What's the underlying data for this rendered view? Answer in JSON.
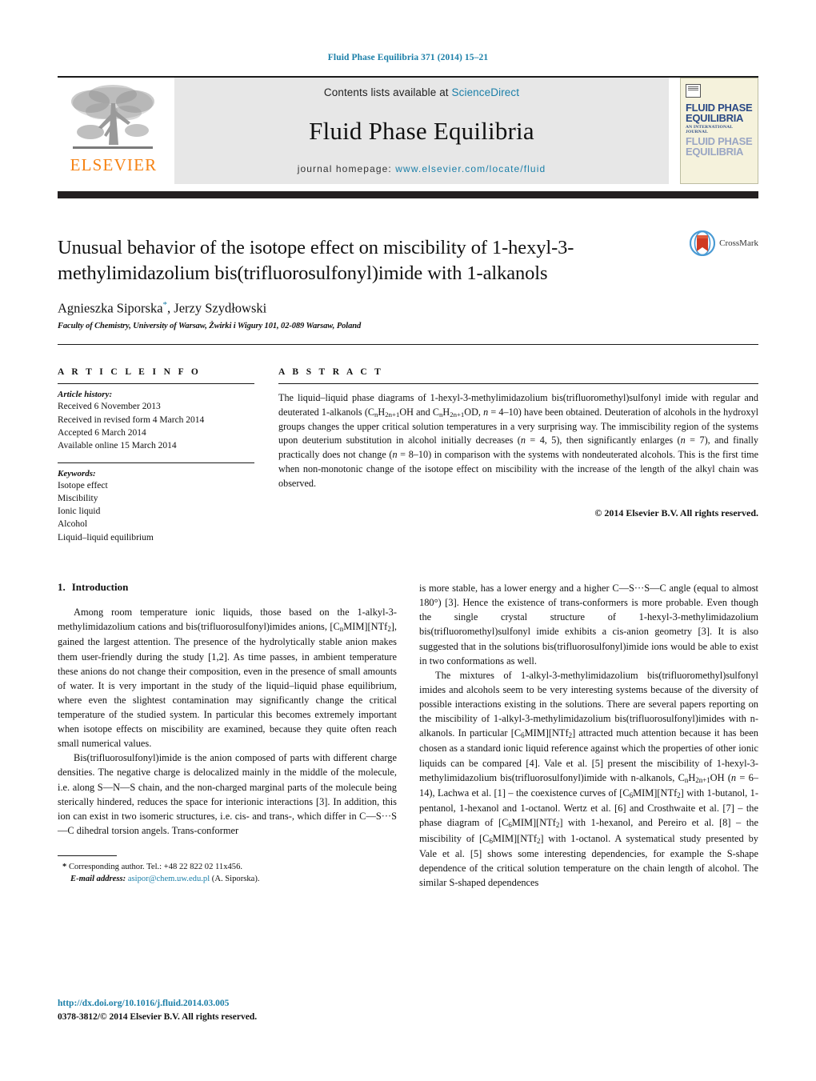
{
  "running_head": "Fluid Phase Equilibria 371 (2014) 15–21",
  "masthead": {
    "publisher_name": "ELSEVIER",
    "contents_prefix": "Contents lists available at",
    "contents_link": "ScienceDirect",
    "journal_title": "Fluid Phase Equilibria",
    "homepage_prefix": "journal homepage:",
    "homepage_url": "www.elsevier.com/locate/fluid",
    "cover": {
      "line1": "FLUID PHASE",
      "line2": "EQUILIBRIA",
      "subtitle": "AN INTERNATIONAL JOURNAL",
      "line3": "FLUID PHASE",
      "line4": "EQUILIBRIA"
    }
  },
  "article": {
    "title": "Unusual behavior of the isotope effect on miscibility of 1-hexyl-3-methylimidazolium bis(trifluorosulfonyl)imide with 1-alkanols",
    "crossmark_label": "CrossMark",
    "authors": "Agnieszka Siporska",
    "authors_second": ", Jerzy Szydłowski",
    "corresponding_marker": "*",
    "affiliation": "Faculty of Chemistry, University of Warsaw, Żwirki i Wigury 101, 02-089 Warsaw, Poland"
  },
  "article_info": {
    "heading": "A R T I C L E    I N F O",
    "history_label": "Article history:",
    "history": [
      "Received 6 November 2013",
      "Received in revised form 4 March 2014",
      "Accepted 6 March 2014",
      "Available online 15 March 2014"
    ],
    "keywords_label": "Keywords:",
    "keywords": [
      "Isotope effect",
      "Miscibility",
      "Ionic liquid",
      "Alcohol",
      "Liquid–liquid equilibrium"
    ]
  },
  "abstract": {
    "heading": "A B S T R A C T",
    "text": "The liquid–liquid phase diagrams of 1-hexyl-3-methylimidazolium bis(trifluoromethyl)sulfonyl imide with regular and deuterated 1-alkanols (CnH2n+1OH and CnH2n+1OD, n = 4–10) have been obtained. Deuteration of alcohols in the hydroxyl groups changes the upper critical solution temperatures in a very surprising way. The immiscibility region of the systems upon deuterium substitution in alcohol initially decreases (n = 4, 5), then significantly enlarges (n = 7), and finally practically does not change (n = 8–10) in comparison with the systems with nondeuterated alcohols. This is the first time when non-monotonic change of the isotope effect on miscibility with the increase of the length of the alkyl chain was observed.",
    "copyright": "© 2014 Elsevier B.V. All rights reserved."
  },
  "introduction": {
    "number": "1.",
    "title": "Introduction",
    "left_paragraphs": [
      "Among room temperature ionic liquids, those based on the 1-alkyl-3-methylimidazolium cations and bis(trifluorosulfonyl)imides anions, [CnMIM][NTf2], gained the largest attention. The presence of the hydrolytically stable anion makes them user-friendly during the study [1,2]. As time passes, in ambient temperature these anions do not change their composition, even in the presence of small amounts of water. It is very important in the study of the liquid–liquid phase equilibrium, where even the slightest contamination may significantly change the critical temperature of the studied system. In particular this becomes extremely important when isotope effects on miscibility are examined, because they quite often reach small numerical values.",
      "Bis(trifluorosulfonyl)imide is the anion composed of parts with different charge densities. The negative charge is delocalized mainly in the middle of the molecule, i.e. along S—N—S chain, and the non-charged marginal parts of the molecule being sterically hindered, reduces the space for interionic interactions [3]. In addition, this ion can exist in two isomeric structures, i.e. cis- and trans-, which differ in C—S···S—C dihedral torsion angels. Trans-conformer"
    ],
    "right_paragraphs": [
      "is more stable, has a lower energy and a higher C—S···S—C angle (equal to almost 180°) [3]. Hence the existence of trans-conformers is more probable. Even though the single crystal structure of 1-hexyl-3-methylimidazolium bis(trifluoromethyl)sulfonyl imide exhibits a cis-anion geometry [3]. It is also suggested that in the solutions bis(trifluorosulfonyl)imide ions would be able to exist in two conformations as well.",
      "The mixtures of 1-alkyl-3-methylimidazolium bis(trifluoromethyl)sulfonyl imides and alcohols seem to be very interesting systems because of the diversity of possible interactions existing in the solutions. There are several papers reporting on the miscibility of 1-alkyl-3-methylimidazolium bis(trifluorosulfonyl)imides with n-alkanols. In particular [C6MIM][NTf2] attracted much attention because it has been chosen as a standard ionic liquid reference against which the properties of other ionic liquids can be compared [4]. Vale et al. [5] present the miscibility of 1-hexyl-3-methylimidazolium bis(trifluorosulfonyl)imide with n-alkanols, CnH2n+1OH (n = 6–14), Lachwa et al. [1] – the coexistence curves of [C6MIM][NTf2] with 1-butanol, 1-pentanol, 1-hexanol and 1-octanol. Wertz et al. [6] and Crosthwaite et al. [7] – the phase diagram of [C6MIM][NTf2] with 1-hexanol, and Pereiro et al. [8] – the miscibility of [C6MIM][NTf2] with 1-octanol. A systematical study presented by Vale et al. [5] shows some interesting dependencies, for example the S-shape dependence of the critical solution temperature on the chain length of alcohol. The similar S-shaped dependences"
    ]
  },
  "footnote": {
    "star": "*",
    "corresponding": "Corresponding author. Tel.: +48 22 822 02 11x456.",
    "email_label": "E-mail address:",
    "email": "asipor@chem.uw.edu.pl",
    "email_suffix": "(A. Siporska)."
  },
  "page_footer": {
    "doi": "http://dx.doi.org/10.1016/j.fluid.2014.03.005",
    "issn_line": "0378-3812/© 2014 Elsevier B.V. All rights reserved."
  },
  "colors": {
    "link": "#1b7fa8",
    "elsevier_orange": "#f68212",
    "bar_dark": "#231f20",
    "masthead_gray": "#e7e7e7",
    "cover_cream": "#f5f2dc",
    "cover_blue": "#2b4a86"
  }
}
